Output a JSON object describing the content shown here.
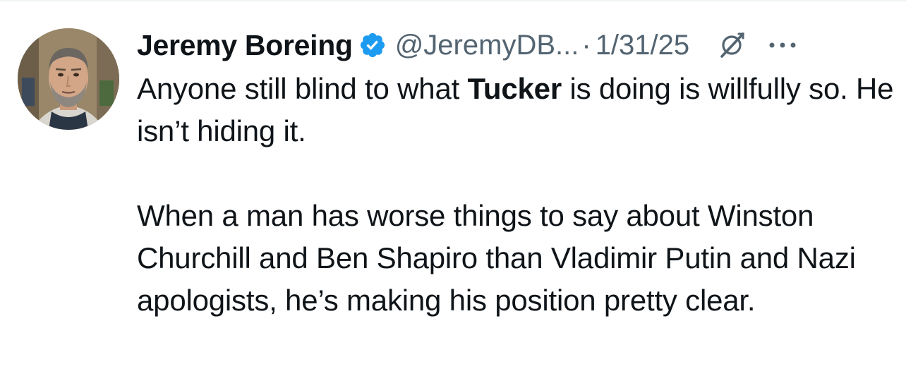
{
  "author": {
    "display_name": "Jeremy Boreing",
    "handle": "@JeremyDB...",
    "verified": true,
    "avatar_icon": "avatar-photo"
  },
  "meta": {
    "separator": "·",
    "date": "1/31/25"
  },
  "icons": {
    "verified": "verified-badge-icon",
    "grok": "grok-icon",
    "more": "more-options-icon"
  },
  "colors": {
    "verified_badge": "#1d9bf0",
    "secondary_text": "#536471",
    "primary_text": "#0f1419"
  },
  "text": {
    "p1_before": "Anyone still blind to what ",
    "p1_bold": "Tucker",
    "p1_after": " is doing is willfully so. He isn’t hiding it.",
    "p2": "When a man has worse things to say about Winston Churchill and Ben Shapiro than Vladimir Putin and Nazi apologists, he’s making his position pretty clear."
  }
}
